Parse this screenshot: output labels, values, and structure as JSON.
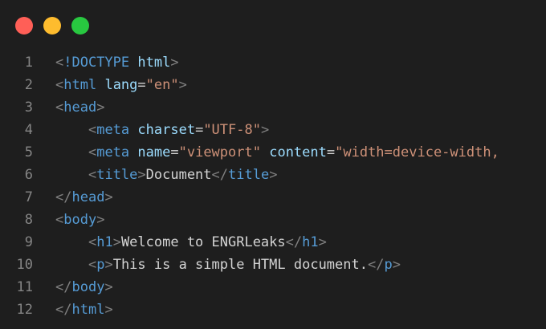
{
  "window": {
    "controls": [
      {
        "name": "close-button",
        "color": "#ff5f57"
      },
      {
        "name": "minimize-button",
        "color": "#febc2e"
      },
      {
        "name": "zoom-button",
        "color": "#28c840"
      }
    ]
  },
  "colors": {
    "background": "#1e1e1e",
    "line_number": "#858585",
    "punctuation": "#808080",
    "tag": "#569cd6",
    "attribute": "#9cdcfe",
    "string": "#ce9178",
    "text": "#d4d4d4"
  },
  "editor": {
    "lines": [
      {
        "num": "1",
        "tokens": [
          {
            "t": "<",
            "c": "punct"
          },
          {
            "t": "!DOCTYPE",
            "c": "tag"
          },
          {
            "t": " ",
            "c": "text"
          },
          {
            "t": "html",
            "c": "attr"
          },
          {
            "t": ">",
            "c": "punct"
          }
        ]
      },
      {
        "num": "2",
        "tokens": [
          {
            "t": "<",
            "c": "punct"
          },
          {
            "t": "html",
            "c": "tag"
          },
          {
            "t": " ",
            "c": "text"
          },
          {
            "t": "lang",
            "c": "attr"
          },
          {
            "t": "=",
            "c": "eq"
          },
          {
            "t": "\"en\"",
            "c": "str"
          },
          {
            "t": ">",
            "c": "punct"
          }
        ]
      },
      {
        "num": "3",
        "tokens": [
          {
            "t": "<",
            "c": "punct"
          },
          {
            "t": "head",
            "c": "tag"
          },
          {
            "t": ">",
            "c": "punct"
          }
        ]
      },
      {
        "num": "4",
        "tokens": [
          {
            "t": "    ",
            "c": "text"
          },
          {
            "t": "<",
            "c": "punct"
          },
          {
            "t": "meta",
            "c": "tag"
          },
          {
            "t": " ",
            "c": "text"
          },
          {
            "t": "charset",
            "c": "attr"
          },
          {
            "t": "=",
            "c": "eq"
          },
          {
            "t": "\"UTF-8\"",
            "c": "str"
          },
          {
            "t": ">",
            "c": "punct"
          }
        ]
      },
      {
        "num": "5",
        "tokens": [
          {
            "t": "    ",
            "c": "text"
          },
          {
            "t": "<",
            "c": "punct"
          },
          {
            "t": "meta",
            "c": "tag"
          },
          {
            "t": " ",
            "c": "text"
          },
          {
            "t": "name",
            "c": "attr"
          },
          {
            "t": "=",
            "c": "eq"
          },
          {
            "t": "\"viewport\"",
            "c": "str"
          },
          {
            "t": " ",
            "c": "text"
          },
          {
            "t": "content",
            "c": "attr"
          },
          {
            "t": "=",
            "c": "eq"
          },
          {
            "t": "\"width=device-width,",
            "c": "str"
          }
        ]
      },
      {
        "num": "6",
        "tokens": [
          {
            "t": "    ",
            "c": "text"
          },
          {
            "t": "<",
            "c": "punct"
          },
          {
            "t": "title",
            "c": "tag"
          },
          {
            "t": ">",
            "c": "punct"
          },
          {
            "t": "Document",
            "c": "text"
          },
          {
            "t": "</",
            "c": "punct"
          },
          {
            "t": "title",
            "c": "tag"
          },
          {
            "t": ">",
            "c": "punct"
          }
        ]
      },
      {
        "num": "7",
        "tokens": [
          {
            "t": "</",
            "c": "punct"
          },
          {
            "t": "head",
            "c": "tag"
          },
          {
            "t": ">",
            "c": "punct"
          }
        ]
      },
      {
        "num": "8",
        "tokens": [
          {
            "t": "<",
            "c": "punct"
          },
          {
            "t": "body",
            "c": "tag"
          },
          {
            "t": ">",
            "c": "punct"
          }
        ]
      },
      {
        "num": "9",
        "tokens": [
          {
            "t": "    ",
            "c": "text"
          },
          {
            "t": "<",
            "c": "punct"
          },
          {
            "t": "h1",
            "c": "tag"
          },
          {
            "t": ">",
            "c": "punct"
          },
          {
            "t": "Welcome to ENGRLeaks",
            "c": "text"
          },
          {
            "t": "</",
            "c": "punct"
          },
          {
            "t": "h1",
            "c": "tag"
          },
          {
            "t": ">",
            "c": "punct"
          }
        ]
      },
      {
        "num": "10",
        "tokens": [
          {
            "t": "    ",
            "c": "text"
          },
          {
            "t": "<",
            "c": "punct"
          },
          {
            "t": "p",
            "c": "tag"
          },
          {
            "t": ">",
            "c": "punct"
          },
          {
            "t": "This is a simple HTML document.",
            "c": "text"
          },
          {
            "t": "</",
            "c": "punct"
          },
          {
            "t": "p",
            "c": "tag"
          },
          {
            "t": ">",
            "c": "punct"
          }
        ]
      },
      {
        "num": "11",
        "tokens": [
          {
            "t": "</",
            "c": "punct"
          },
          {
            "t": "body",
            "c": "tag"
          },
          {
            "t": ">",
            "c": "punct"
          }
        ]
      },
      {
        "num": "12",
        "tokens": [
          {
            "t": "</",
            "c": "punct"
          },
          {
            "t": "html",
            "c": "tag"
          },
          {
            "t": ">",
            "c": "punct"
          }
        ]
      }
    ]
  }
}
